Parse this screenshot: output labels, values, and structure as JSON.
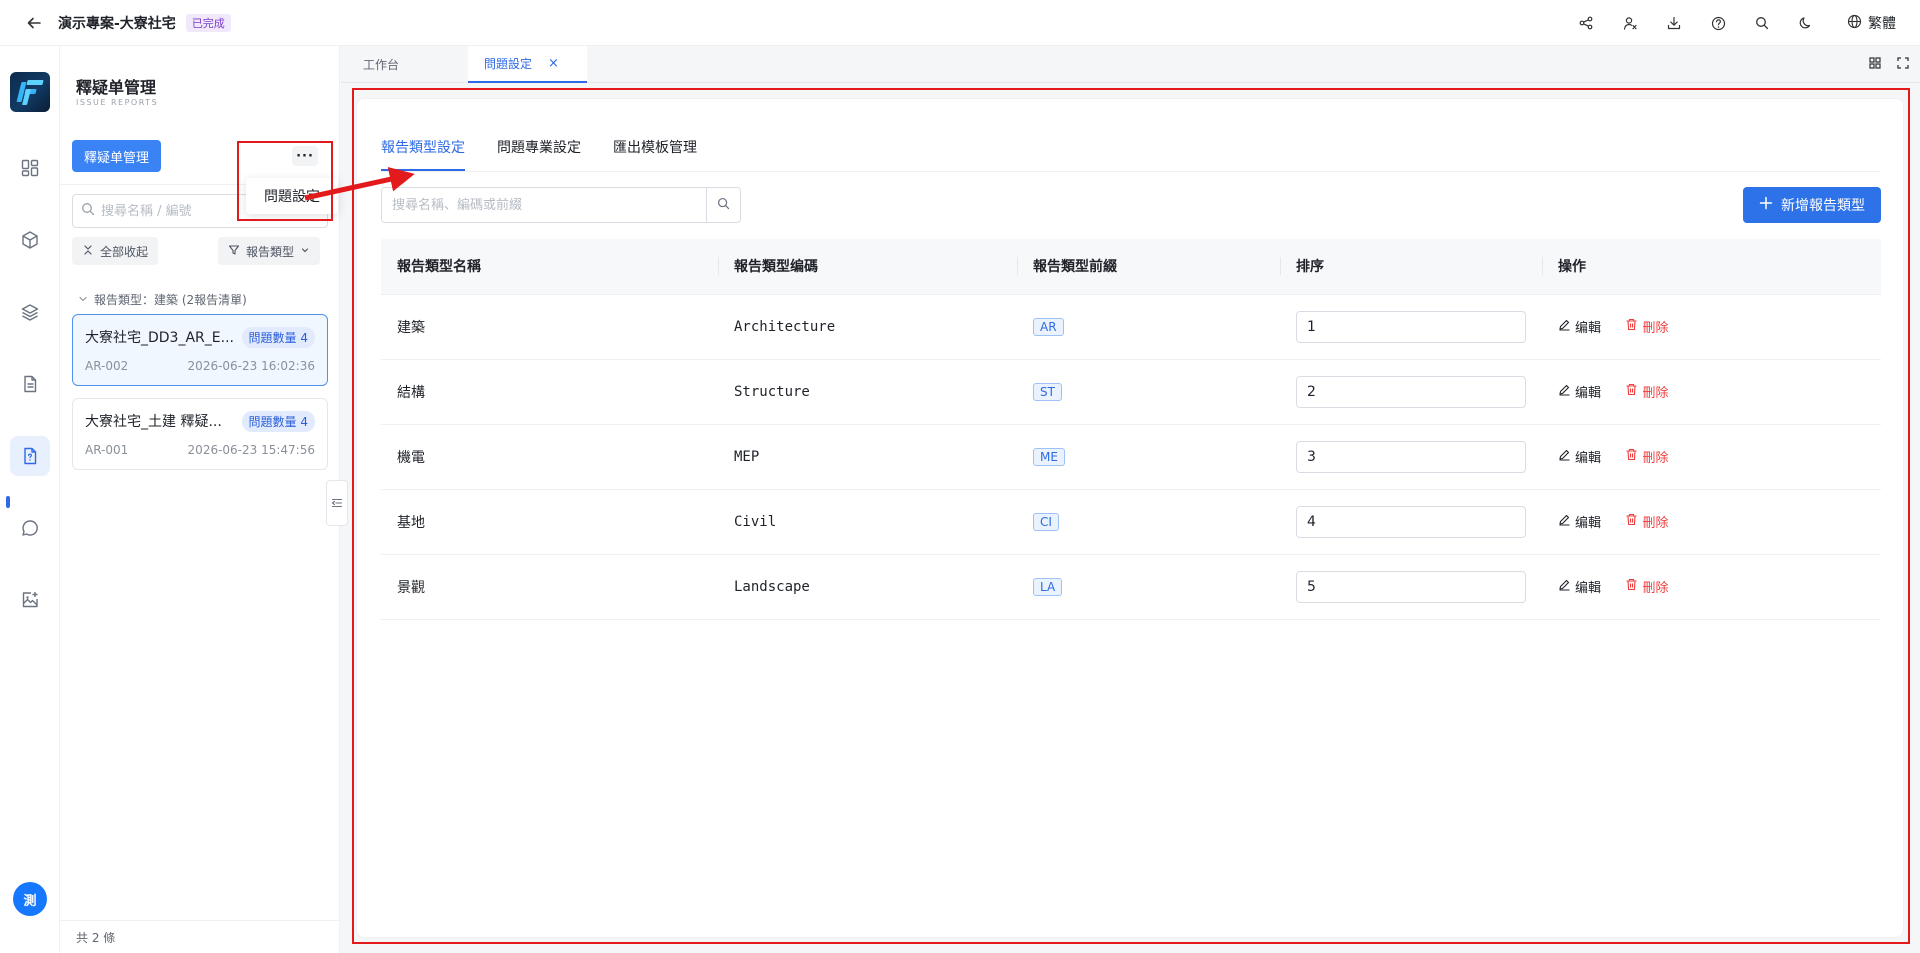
{
  "header": {
    "project_title": "演示專案-大寮社宅",
    "status": "已完成",
    "language": "繁體",
    "icons": [
      "share-icon",
      "user-switch-icon",
      "download-icon",
      "help-icon",
      "search-icon",
      "moon-icon",
      "globe-icon"
    ]
  },
  "rail": {
    "items": [
      "dashboard-icon",
      "cube-icon",
      "layers-icon",
      "document-icon",
      "issue-report-icon",
      "chat-icon",
      "image-add-icon"
    ],
    "active_item": "issue-report-icon",
    "avatar_text": "測"
  },
  "panel": {
    "title": "釋疑单管理",
    "subtitle": "ISSUE REPORTS",
    "primary_button": "釋疑单管理",
    "more_button": "···",
    "search_placeholder": "搜尋名稱 / 編號",
    "collapse_all": "全部收起",
    "filter_label": "報告類型",
    "group_label": "報告類型：建築 (2報告清單)",
    "reports": [
      {
        "title": "大寮社宅_DD3_AR_E...",
        "badge": "問題數量 4",
        "code": "AR-002",
        "time": "2026-06-23 16:02:36"
      },
      {
        "title": "大寮社宅_土建 釋疑...",
        "badge": "問題數量 4",
        "code": "AR-001",
        "time": "2026-06-23 15:47:56"
      }
    ],
    "footer": "共 2 條"
  },
  "dropdown": {
    "item": "問題設定"
  },
  "tabs": [
    {
      "label": "工作台"
    },
    {
      "label": "問題設定",
      "close": "×"
    }
  ],
  "main": {
    "sub_tabs": [
      "報告類型設定",
      "問題專業設定",
      "匯出模板管理"
    ],
    "search_placeholder": "搜尋名稱、編碼或前綴",
    "add_button": "新增報告類型",
    "columns": [
      "報告類型名稱",
      "報告類型编碼",
      "報告類型前綴",
      "排序",
      "操作"
    ],
    "rows": [
      {
        "name": "建築",
        "code": "Architecture",
        "prefix": "AR",
        "order": "1"
      },
      {
        "name": "結構",
        "code": "Structure",
        "prefix": "ST",
        "order": "2"
      },
      {
        "name": "機電",
        "code": "MEP",
        "prefix": "ME",
        "order": "3"
      },
      {
        "name": "基地",
        "code": "Civil",
        "prefix": "CI",
        "order": "4"
      },
      {
        "name": "景觀",
        "code": "Landscape",
        "prefix": "LA",
        "order": "5"
      }
    ],
    "edit_label": "编輯",
    "delete_label": "刪除"
  },
  "colors": {
    "accent": "#2f6ae6",
    "annotation": "#e31a1c",
    "danger": "#f03e3e"
  }
}
